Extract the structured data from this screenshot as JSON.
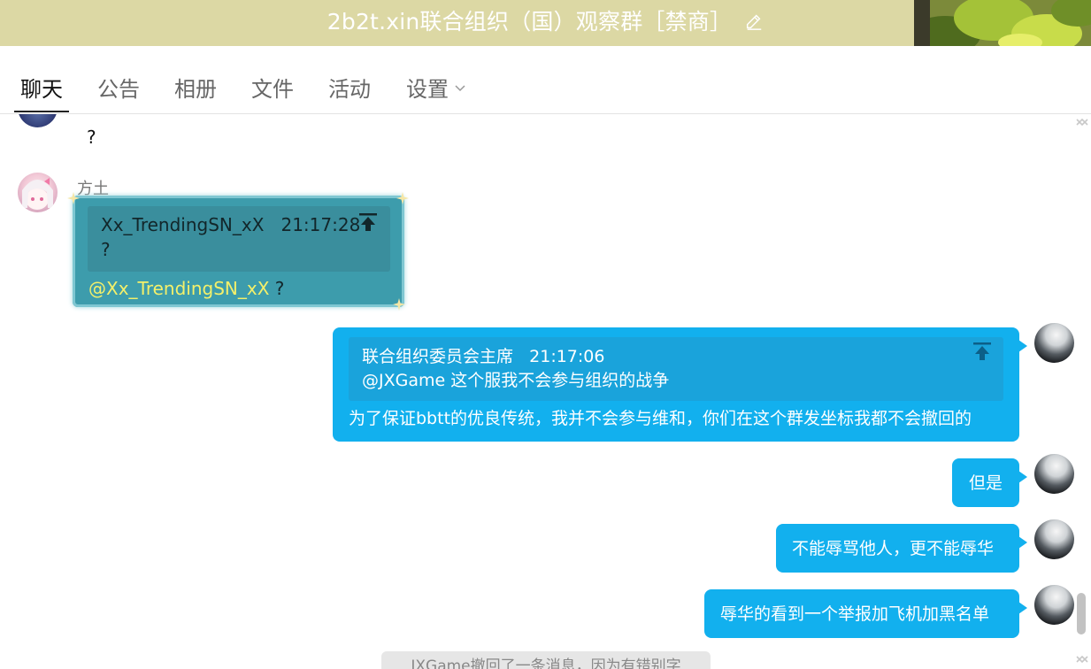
{
  "header": {
    "title": "2b2t.xin联合组织（国）观察群［禁商］"
  },
  "tabs": [
    {
      "label": "聊天"
    },
    {
      "label": "公告"
    },
    {
      "label": "相册"
    },
    {
      "label": "文件"
    },
    {
      "label": "活动"
    },
    {
      "label": "设置"
    }
  ],
  "messages": {
    "prev_text": "?",
    "m1": {
      "sender": "方土",
      "quote_author": "Xx_TrendingSN_xX",
      "quote_time": "21:17:28",
      "quote_text": "?",
      "mention": "@Xx_TrendingSN_xX",
      "text": " ?"
    },
    "m2": {
      "quote_author": "联合组织委员会主席",
      "quote_time": "21:17:06",
      "quote_text": "@JXGame 这个服我不会参与组织的战争",
      "text": "为了保证bbtt的优良传统，我并不会参与维和，你们在这个群发坐标我都不会撤回的"
    },
    "m3": {
      "text": "但是"
    },
    "m4": {
      "text": "不能辱骂他人，更不能辱华"
    },
    "m5": {
      "text": "辱华的看到一个举报加飞机加黑名单"
    }
  },
  "system_notice": "JXGame撤回了一条消息，因为有错别字",
  "colors": {
    "titlebar": "#dcd8a4",
    "bubble_blue": "#12b0ee",
    "bubble_teal": "#3d9cac",
    "mention": "#f4f06a"
  }
}
